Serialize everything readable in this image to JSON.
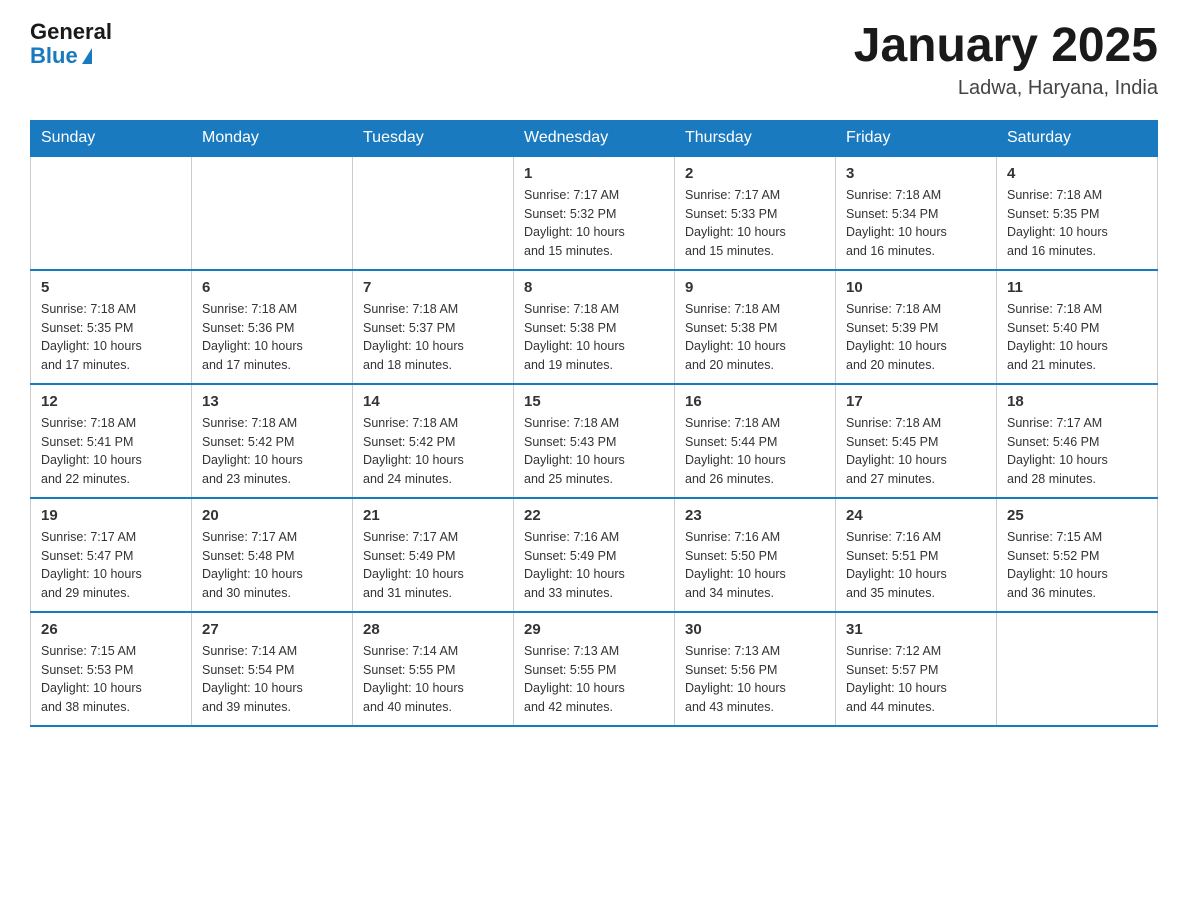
{
  "header": {
    "logo_general": "General",
    "logo_blue": "Blue",
    "month_title": "January 2025",
    "location": "Ladwa, Haryana, India"
  },
  "days_of_week": [
    "Sunday",
    "Monday",
    "Tuesday",
    "Wednesday",
    "Thursday",
    "Friday",
    "Saturday"
  ],
  "weeks": [
    [
      {
        "day": "",
        "info": ""
      },
      {
        "day": "",
        "info": ""
      },
      {
        "day": "",
        "info": ""
      },
      {
        "day": "1",
        "info": "Sunrise: 7:17 AM\nSunset: 5:32 PM\nDaylight: 10 hours\nand 15 minutes."
      },
      {
        "day": "2",
        "info": "Sunrise: 7:17 AM\nSunset: 5:33 PM\nDaylight: 10 hours\nand 15 minutes."
      },
      {
        "day": "3",
        "info": "Sunrise: 7:18 AM\nSunset: 5:34 PM\nDaylight: 10 hours\nand 16 minutes."
      },
      {
        "day": "4",
        "info": "Sunrise: 7:18 AM\nSunset: 5:35 PM\nDaylight: 10 hours\nand 16 minutes."
      }
    ],
    [
      {
        "day": "5",
        "info": "Sunrise: 7:18 AM\nSunset: 5:35 PM\nDaylight: 10 hours\nand 17 minutes."
      },
      {
        "day": "6",
        "info": "Sunrise: 7:18 AM\nSunset: 5:36 PM\nDaylight: 10 hours\nand 17 minutes."
      },
      {
        "day": "7",
        "info": "Sunrise: 7:18 AM\nSunset: 5:37 PM\nDaylight: 10 hours\nand 18 minutes."
      },
      {
        "day": "8",
        "info": "Sunrise: 7:18 AM\nSunset: 5:38 PM\nDaylight: 10 hours\nand 19 minutes."
      },
      {
        "day": "9",
        "info": "Sunrise: 7:18 AM\nSunset: 5:38 PM\nDaylight: 10 hours\nand 20 minutes."
      },
      {
        "day": "10",
        "info": "Sunrise: 7:18 AM\nSunset: 5:39 PM\nDaylight: 10 hours\nand 20 minutes."
      },
      {
        "day": "11",
        "info": "Sunrise: 7:18 AM\nSunset: 5:40 PM\nDaylight: 10 hours\nand 21 minutes."
      }
    ],
    [
      {
        "day": "12",
        "info": "Sunrise: 7:18 AM\nSunset: 5:41 PM\nDaylight: 10 hours\nand 22 minutes."
      },
      {
        "day": "13",
        "info": "Sunrise: 7:18 AM\nSunset: 5:42 PM\nDaylight: 10 hours\nand 23 minutes."
      },
      {
        "day": "14",
        "info": "Sunrise: 7:18 AM\nSunset: 5:42 PM\nDaylight: 10 hours\nand 24 minutes."
      },
      {
        "day": "15",
        "info": "Sunrise: 7:18 AM\nSunset: 5:43 PM\nDaylight: 10 hours\nand 25 minutes."
      },
      {
        "day": "16",
        "info": "Sunrise: 7:18 AM\nSunset: 5:44 PM\nDaylight: 10 hours\nand 26 minutes."
      },
      {
        "day": "17",
        "info": "Sunrise: 7:18 AM\nSunset: 5:45 PM\nDaylight: 10 hours\nand 27 minutes."
      },
      {
        "day": "18",
        "info": "Sunrise: 7:17 AM\nSunset: 5:46 PM\nDaylight: 10 hours\nand 28 minutes."
      }
    ],
    [
      {
        "day": "19",
        "info": "Sunrise: 7:17 AM\nSunset: 5:47 PM\nDaylight: 10 hours\nand 29 minutes."
      },
      {
        "day": "20",
        "info": "Sunrise: 7:17 AM\nSunset: 5:48 PM\nDaylight: 10 hours\nand 30 minutes."
      },
      {
        "day": "21",
        "info": "Sunrise: 7:17 AM\nSunset: 5:49 PM\nDaylight: 10 hours\nand 31 minutes."
      },
      {
        "day": "22",
        "info": "Sunrise: 7:16 AM\nSunset: 5:49 PM\nDaylight: 10 hours\nand 33 minutes."
      },
      {
        "day": "23",
        "info": "Sunrise: 7:16 AM\nSunset: 5:50 PM\nDaylight: 10 hours\nand 34 minutes."
      },
      {
        "day": "24",
        "info": "Sunrise: 7:16 AM\nSunset: 5:51 PM\nDaylight: 10 hours\nand 35 minutes."
      },
      {
        "day": "25",
        "info": "Sunrise: 7:15 AM\nSunset: 5:52 PM\nDaylight: 10 hours\nand 36 minutes."
      }
    ],
    [
      {
        "day": "26",
        "info": "Sunrise: 7:15 AM\nSunset: 5:53 PM\nDaylight: 10 hours\nand 38 minutes."
      },
      {
        "day": "27",
        "info": "Sunrise: 7:14 AM\nSunset: 5:54 PM\nDaylight: 10 hours\nand 39 minutes."
      },
      {
        "day": "28",
        "info": "Sunrise: 7:14 AM\nSunset: 5:55 PM\nDaylight: 10 hours\nand 40 minutes."
      },
      {
        "day": "29",
        "info": "Sunrise: 7:13 AM\nSunset: 5:55 PM\nDaylight: 10 hours\nand 42 minutes."
      },
      {
        "day": "30",
        "info": "Sunrise: 7:13 AM\nSunset: 5:56 PM\nDaylight: 10 hours\nand 43 minutes."
      },
      {
        "day": "31",
        "info": "Sunrise: 7:12 AM\nSunset: 5:57 PM\nDaylight: 10 hours\nand 44 minutes."
      },
      {
        "day": "",
        "info": ""
      }
    ]
  ]
}
